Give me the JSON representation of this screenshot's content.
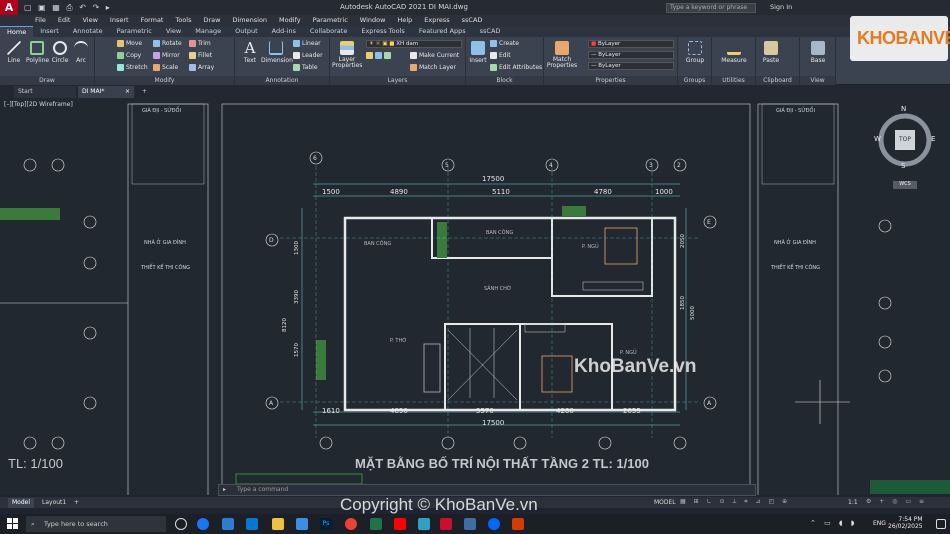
{
  "app": {
    "window_title": "Autodesk AutoCAD 2021   DI MAI.dwg",
    "search_placeholder": "Type a keyword or phrase",
    "sign_in": "Sign In"
  },
  "menu": [
    "File",
    "Edit",
    "View",
    "Insert",
    "Format",
    "Tools",
    "Draw",
    "Dimension",
    "Modify",
    "Parametric",
    "Window",
    "Help",
    "Express",
    "ssCAD"
  ],
  "ribbon_tabs": [
    "Home",
    "Insert",
    "Annotate",
    "Parametric",
    "View",
    "Manage",
    "Output",
    "Add-ins",
    "Collaborate",
    "Express Tools",
    "Featured Apps",
    "ssCAD"
  ],
  "ribbon": {
    "draw": {
      "footer": "Draw",
      "tools": [
        "Line",
        "Polyline",
        "Circle",
        "Arc"
      ]
    },
    "modify": {
      "footer": "Modify",
      "tools": [
        "Move",
        "Rotate",
        "Trim",
        "Copy",
        "Mirror",
        "Fillet",
        "Stretch",
        "Scale",
        "Array"
      ]
    },
    "annotation": {
      "footer": "Annotation",
      "tools": [
        "Text",
        "Dimension",
        "Linear",
        "Leader",
        "Table"
      ]
    },
    "layers": {
      "footer": "Layers",
      "layer_props": "Layer Properties",
      "current_layer": "XH dam",
      "tools": [
        "Make Current",
        "Match Layer"
      ]
    },
    "block": {
      "footer": "Block",
      "insert": "Insert",
      "tools": [
        "Create",
        "Edit",
        "Edit Attributes"
      ]
    },
    "properties": {
      "footer": "Properties",
      "match": "Match Properties",
      "values": [
        "ByLayer",
        "ByLayer",
        "ByLayer"
      ]
    },
    "groups": {
      "footer": "Groups",
      "label": "Group"
    },
    "utilities": {
      "footer": "Utilities",
      "label": "Measure"
    },
    "clipboard": {
      "footer": "Clipboard",
      "label": "Paste"
    },
    "view": {
      "footer": "View",
      "label": "Base"
    }
  },
  "doc_tabs": [
    "Start",
    "DI MAI*"
  ],
  "viewport_label": "[–][Top][2D Wireframe]",
  "drawing": {
    "title": "MẶT BẰNG BỐ TRÍ NỘI THẤT TẦNG 2 TL: 1/100",
    "left_scale": "TL: 1/100",
    "dims_top": [
      "17500",
      "1500",
      "4890",
      "5110",
      "4780",
      "1000"
    ],
    "dims_bottom": [
      "1610",
      "4890",
      "3570",
      "4260",
      "2055",
      "17500"
    ],
    "grid_top": [
      "6",
      "7",
      "5",
      "4",
      "3",
      "2",
      "1"
    ],
    "grid_side": [
      "E",
      "D",
      "C",
      "B",
      "A"
    ],
    "rooms": [
      "BAN CÔNG",
      "BAN CÔNG",
      "P. NGỦ",
      "SẢNH CHỜ",
      "P. THỜ",
      "P. NGỦ"
    ],
    "title_block": [
      "GIÁ ĐỊI - SỬĐỔI",
      "NHÀ Ở GIA ĐÌNH",
      "THIẾT KẾ THI CÔNG"
    ],
    "viewcube": {
      "n": "N",
      "w": "W",
      "e": "E",
      "s": "S",
      "top": "TOP",
      "wcs": "WCS"
    },
    "side_labels": [
      "110",
      "1300",
      "3390",
      "8120",
      "1570",
      "240",
      "110",
      "5000",
      "1850",
      "2050"
    ]
  },
  "command_placeholder": "Type a command",
  "layout_tabs": [
    "Model",
    "Layout1"
  ],
  "status": {
    "model": "MODEL",
    "scale": "1:1"
  },
  "watermarks": [
    "KhoBanVe.vn",
    "Copyright © KhoBanVe.vn"
  ],
  "logo_text": "KHOBANVE",
  "taskbar": {
    "search": "Type here to search",
    "time": "7:54 PM",
    "date": "26/02/2025",
    "lang": "ENG"
  }
}
